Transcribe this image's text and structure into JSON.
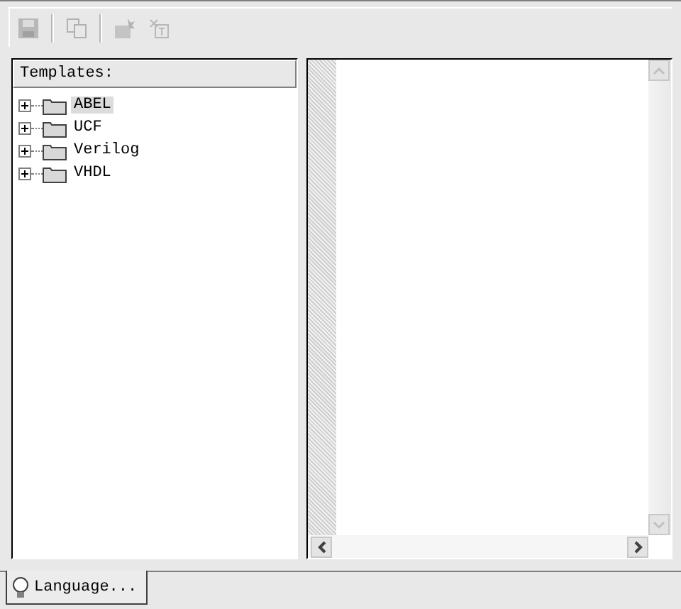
{
  "toolbar": [
    {
      "kind": "save",
      "disabled": true
    },
    {
      "kind": "sep"
    },
    {
      "kind": "copy",
      "disabled": true
    },
    {
      "kind": "sep"
    },
    {
      "kind": "use",
      "disabled": true
    },
    {
      "kind": "paste",
      "disabled": true
    }
  ],
  "templates": {
    "header": "Templates:",
    "items": [
      {
        "label": "ABEL",
        "expanded": false,
        "selected": true
      },
      {
        "label": "UCF",
        "expanded": false,
        "selected": false
      },
      {
        "label": "Verilog",
        "expanded": false,
        "selected": false
      },
      {
        "label": "VHDL",
        "expanded": false,
        "selected": false
      }
    ]
  },
  "tabs": [
    {
      "label": "Language...",
      "selected": true
    }
  ]
}
